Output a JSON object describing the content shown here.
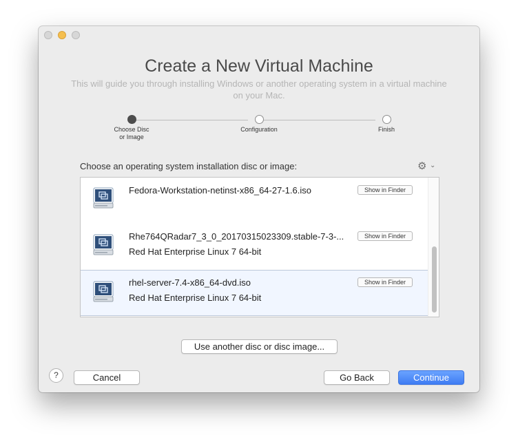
{
  "window": {
    "title": "Create a New Virtual Machine",
    "subtitle_line1": "This will guide you through installing Windows or another operating system in a virtual machine",
    "subtitle_line2": "on your Mac."
  },
  "steps": [
    {
      "label_line1": "Choose Disc",
      "label_line2": "or Image",
      "active": true
    },
    {
      "label_line1": "Configuration",
      "label_line2": "",
      "active": false
    },
    {
      "label_line1": "Finish",
      "label_line2": "",
      "active": false
    }
  ],
  "list": {
    "prompt": "Choose an operating system installation disc or image:",
    "gear_icon": "gear-icon",
    "items": [
      {
        "iso": "Fedora-Workstation-netinst-x86_64-27-1.6.iso",
        "os": "",
        "button": "Show in Finder",
        "selected": false
      },
      {
        "iso": "Rhe764QRadar7_3_0_20170315023309.stable-7-3-...",
        "os": "Red Hat Enterprise Linux 7 64-bit",
        "button": "Show in Finder",
        "selected": false
      },
      {
        "iso": "rhel-server-7.4-x86_64-dvd.iso",
        "os": "Red Hat Enterprise Linux 7 64-bit",
        "button": "Show in Finder",
        "selected": true
      }
    ]
  },
  "buttons": {
    "use_another": "Use another disc or disc image...",
    "help": "?",
    "cancel": "Cancel",
    "go_back": "Go Back",
    "continue": "Continue"
  },
  "colors": {
    "accent": "#3f7cf3",
    "minimize": "#f5bf4f"
  }
}
